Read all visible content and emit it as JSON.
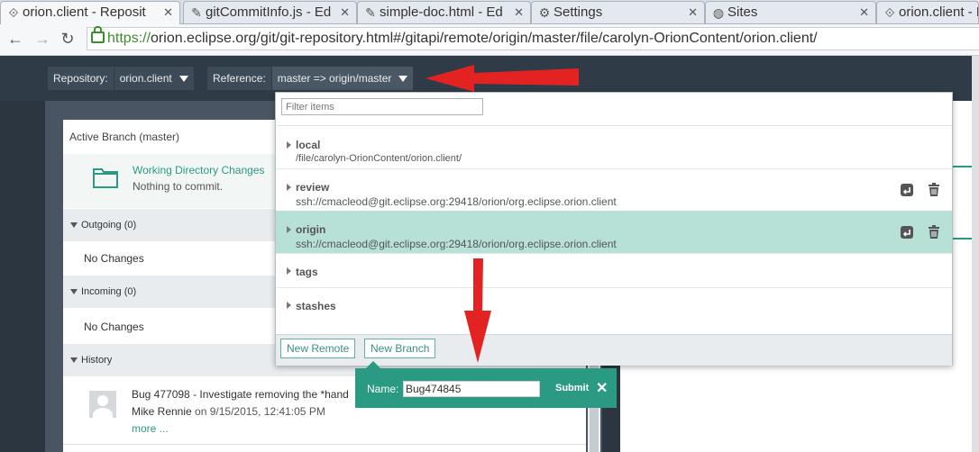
{
  "tabs": [
    {
      "label": "orion.client - Reposit",
      "icon": "orion-diamond-icon",
      "active": true
    },
    {
      "label": "gitCommitInfo.js - Ed",
      "icon": "pencil-icon",
      "active": false
    },
    {
      "label": "simple-doc.html - Ed",
      "icon": "pencil-icon",
      "active": false
    },
    {
      "label": "Settings",
      "icon": "gear-icon",
      "active": false
    },
    {
      "label": "Sites",
      "icon": "globe-icon",
      "active": false
    },
    {
      "label": "orion.client - Reposit",
      "icon": "orion-diamond-icon",
      "active": false
    }
  ],
  "address": {
    "scheme": "https://",
    "rest": "orion.eclipse.org/git/git-repository.html#/gitapi/remote/origin/master/file/carolyn-OrionContent/orion.client/"
  },
  "toolbar": {
    "repository_label": "Repository:",
    "repository_value": "orion.client",
    "reference_label": "Reference:",
    "reference_value": "master => origin/master"
  },
  "side": {
    "active_branch": "Active Branch (master)",
    "working_dir_title": "Working Directory Changes",
    "working_dir_sub": "Nothing to commit.",
    "outgoing": "Outgoing (0)",
    "outgoing_empty": "No Changes",
    "incoming": "Incoming (0)",
    "incoming_empty": "No Changes",
    "history": "History",
    "commit_title": "Bug 477098 - Investigate removing the *hand",
    "commit_author": "Mike Rennie",
    "commit_date": " on 9/15/2015, 12:41:05 PM",
    "more": "more ..."
  },
  "dropdown": {
    "filter_placeholder": "Filter items",
    "items": [
      {
        "name": "local",
        "url": "/file/carolyn-OrionContent/orion.client/"
      },
      {
        "name": "review",
        "url": "ssh://cmacleod@git.eclipse.org:29418/orion/org.eclipse.orion.client"
      },
      {
        "name": "origin",
        "url": "ssh://cmacleod@git.eclipse.org:29418/orion/org.eclipse.orion.client",
        "selected": true
      },
      {
        "name": "tags",
        "url": ""
      },
      {
        "name": "stashes",
        "url": ""
      }
    ],
    "new_remote": "New Remote",
    "new_branch": "New Branch"
  },
  "popup": {
    "name_label": "Name:",
    "name_value": "Bug474845",
    "submit": "Submit"
  },
  "colors": {
    "accent": "#2a9a83",
    "selected_row": "#b7e0d6",
    "annotation_arrow": "#e32222"
  }
}
